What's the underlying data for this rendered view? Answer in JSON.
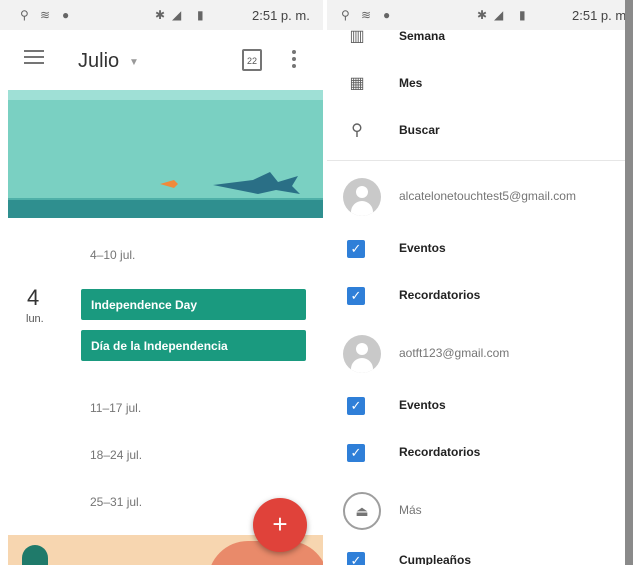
{
  "status_bar": {
    "time": "2:51 p. m.",
    "time_right": "2:51 p. m",
    "left_icons": [
      "usb-icon",
      "wifi-icon",
      "android-icon"
    ],
    "right_icons": [
      "bluetooth-icon",
      "signal-icon",
      "battery-icon"
    ]
  },
  "calendar": {
    "month": "Julio",
    "today_icon_text": "22",
    "weeks": [
      "4–10 jul.",
      "11–17 jul.",
      "18–24 jul.",
      "25–31 jul."
    ],
    "day": {
      "number": "4",
      "weekday": "lun."
    },
    "events": [
      "Independence Day",
      "Día de la Independencia"
    ],
    "fab_label": "+"
  },
  "drawer": {
    "views": [
      {
        "icon": "week-view-icon",
        "label": "Semana"
      },
      {
        "icon": "month-view-icon",
        "label": "Mes"
      },
      {
        "icon": "search-icon",
        "label": "Buscar"
      }
    ],
    "accounts": [
      {
        "email": "alcatelonetouchtest5@gmail.com",
        "items": [
          "Eventos",
          "Recordatorios"
        ]
      },
      {
        "email": "aotft123@gmail.com",
        "items": [
          "Eventos",
          "Recordatorios"
        ]
      }
    ],
    "more_label": "Más",
    "birthdays_label": "Cumpleaños"
  },
  "colors": {
    "event": "#1a9a7f",
    "fab": "#e0423a",
    "checkbox": "#2f7fd8",
    "banner": "#7ad0c2"
  }
}
